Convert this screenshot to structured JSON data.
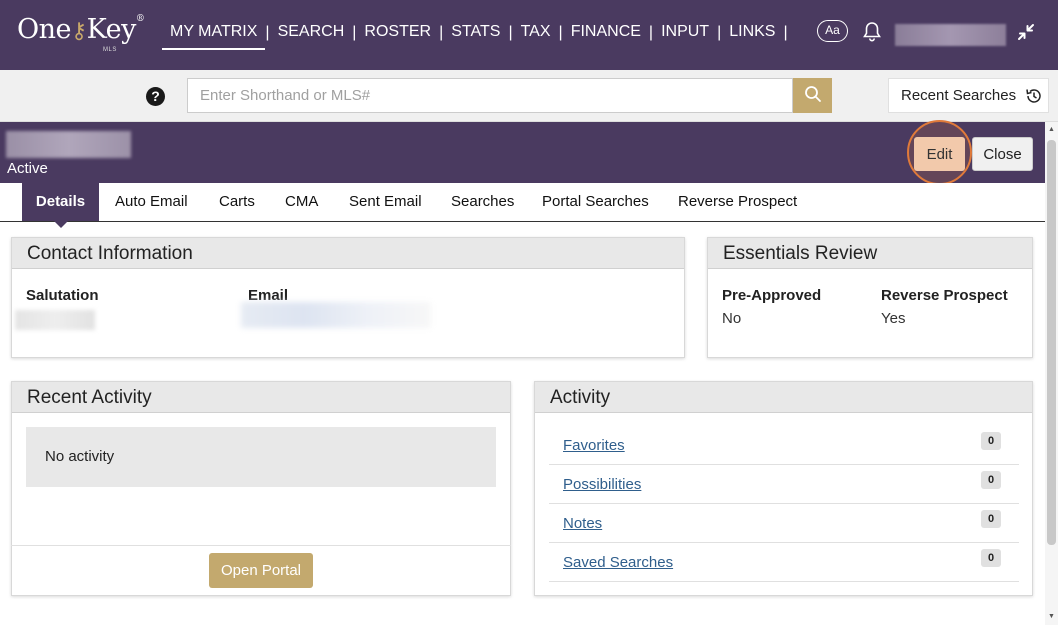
{
  "brand": {
    "name": "OneKey",
    "sub": "MLS",
    "reg": "®"
  },
  "nav": {
    "items": [
      "MY MATRIX",
      "SEARCH",
      "ROSTER",
      "STATS",
      "TAX",
      "FINANCE",
      "INPUT",
      "LINKS"
    ],
    "active": "MY MATRIX",
    "text_size_label": "Aa"
  },
  "search": {
    "placeholder": "Enter Shorthand or MLS#",
    "value": "",
    "recent_label": "Recent Searches"
  },
  "contact_header": {
    "status": "Active",
    "edit_label": "Edit",
    "close_label": "Close"
  },
  "tabs": [
    "Details",
    "Auto Email",
    "Carts",
    "CMA",
    "Sent Email",
    "Searches",
    "Portal Searches",
    "Reverse Prospect"
  ],
  "contact_info": {
    "title": "Contact Information",
    "salutation_label": "Salutation",
    "email_label": "Email"
  },
  "essentials": {
    "title": "Essentials Review",
    "preapproved_label": "Pre-Approved",
    "preapproved_value": "No",
    "reverse_label": "Reverse Prospect",
    "reverse_value": "Yes"
  },
  "recent_activity": {
    "title": "Recent Activity",
    "empty_text": "No activity",
    "portal_label": "Open Portal"
  },
  "activity": {
    "title": "Activity",
    "rows": [
      {
        "label": "Favorites",
        "count": "0"
      },
      {
        "label": "Possibilities",
        "count": "0"
      },
      {
        "label": "Notes",
        "count": "0"
      },
      {
        "label": "Saved Searches",
        "count": "0"
      }
    ]
  },
  "colors": {
    "primary": "#4a3a60",
    "accent": "#c3a96e",
    "link": "#2f5e8c",
    "highlight": "#e07a3a"
  }
}
